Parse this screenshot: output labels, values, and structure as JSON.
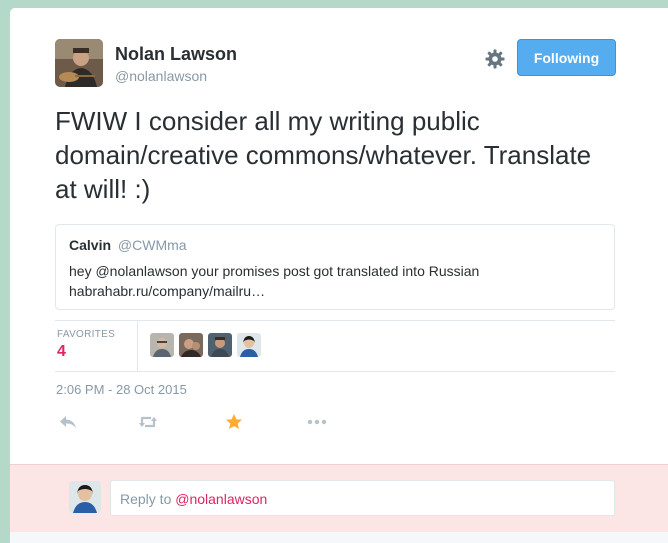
{
  "tweet": {
    "author": {
      "name": "Nolan Lawson",
      "handle": "@nolanlawson"
    },
    "follow_label": "Following",
    "text": "FWIW I consider all my writing public domain/creative commons/whatever. Translate at will! :)",
    "quoted": {
      "name": "Calvin",
      "handle": "@CWMma",
      "text": "hey @nolanlawson your promises post got translated into Russian habrahabr.ru/company/mailru…"
    },
    "stats": {
      "favorites_label": "FAVORITES",
      "favorites_count": "4"
    },
    "timestamp": "2:06 PM - 28 Oct 2015",
    "icons": [
      "reply-icon",
      "retweet-icon",
      "favorite-star-icon",
      "more-icon",
      "gear-icon"
    ]
  },
  "reply": {
    "prefix": "Reply to ",
    "mention": "@nolanlawson"
  },
  "colors": {
    "page_bg": "#b5d9c8",
    "follow_button": "#55acee",
    "favorite": "#e0245e",
    "star_active": "#ffac33",
    "reply_bar": "#fbe5e5",
    "muted": "#8899a6"
  }
}
